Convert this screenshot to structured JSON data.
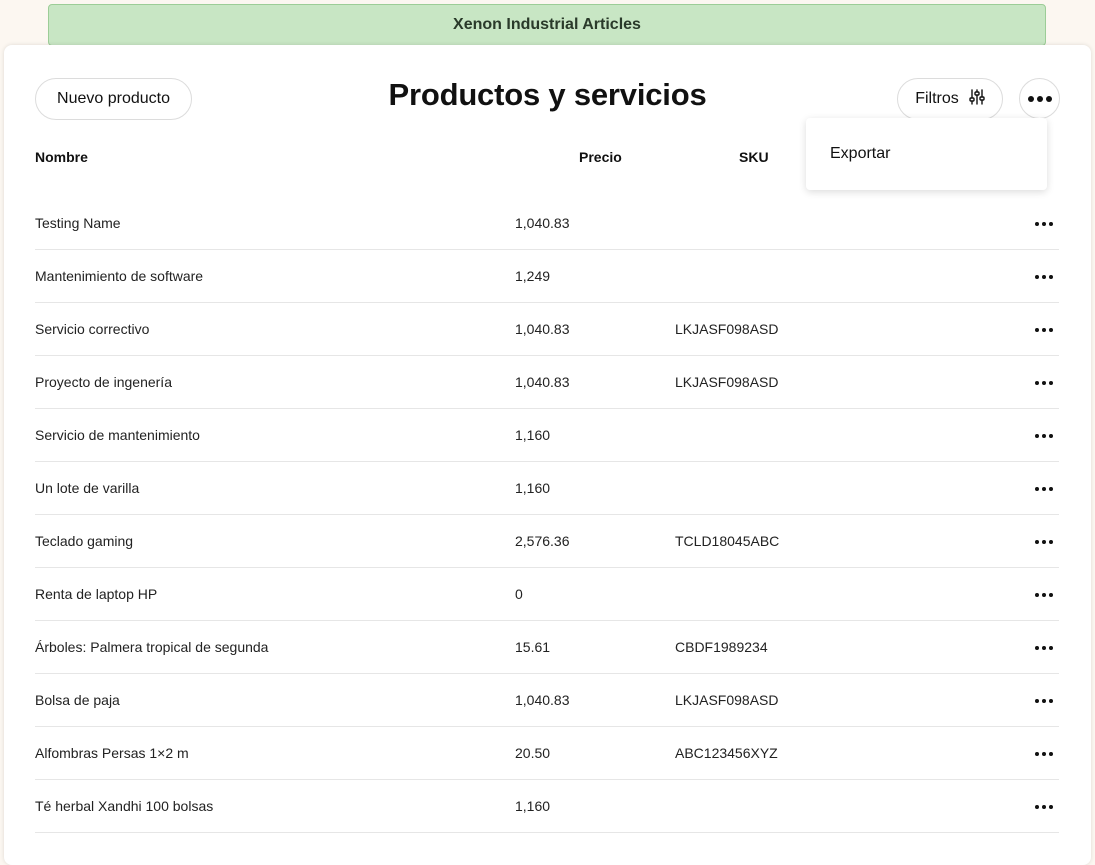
{
  "banner": {
    "title": "Xenon Industrial Articles"
  },
  "header": {
    "new_product_label": "Nuevo producto",
    "page_title": "Productos y servicios",
    "filters_label": "Filtros"
  },
  "dropdown": {
    "export_label": "Exportar"
  },
  "table": {
    "columns": {
      "name": "Nombre",
      "price": "Precio",
      "sku": "SKU"
    },
    "rows": [
      {
        "name": "Testing Name",
        "price": "1,040.83",
        "sku": ""
      },
      {
        "name": "Mantenimiento de software",
        "price": "1,249",
        "sku": ""
      },
      {
        "name": "Servicio correctivo",
        "price": "1,040.83",
        "sku": "LKJASF098ASD"
      },
      {
        "name": "Proyecto de ingenería",
        "price": "1,040.83",
        "sku": "LKJASF098ASD"
      },
      {
        "name": "Servicio de mantenimiento",
        "price": "1,160",
        "sku": ""
      },
      {
        "name": "Un lote de varilla",
        "price": "1,160",
        "sku": ""
      },
      {
        "name": "Teclado gaming",
        "price": "2,576.36",
        "sku": "TCLD18045ABC"
      },
      {
        "name": "Renta de laptop HP",
        "price": "0",
        "sku": ""
      },
      {
        "name": "Árboles: Palmera tropical de segunda",
        "price": "15.61",
        "sku": "CBDF1989234"
      },
      {
        "name": "Bolsa de paja",
        "price": "1,040.83",
        "sku": "LKJASF098ASD"
      },
      {
        "name": "Alfombras Persas 1×2 m",
        "price": "20.50",
        "sku": "ABC123456XYZ"
      },
      {
        "name": "Té herbal Xandhi 100 bolsas",
        "price": "1,160",
        "sku": ""
      }
    ]
  },
  "icons": {
    "filters": "sliders-icon",
    "more": "ellipsis-icon"
  },
  "colors": {
    "banner_bg": "#c8e6c4",
    "page_bg": "#fcf7f1"
  }
}
